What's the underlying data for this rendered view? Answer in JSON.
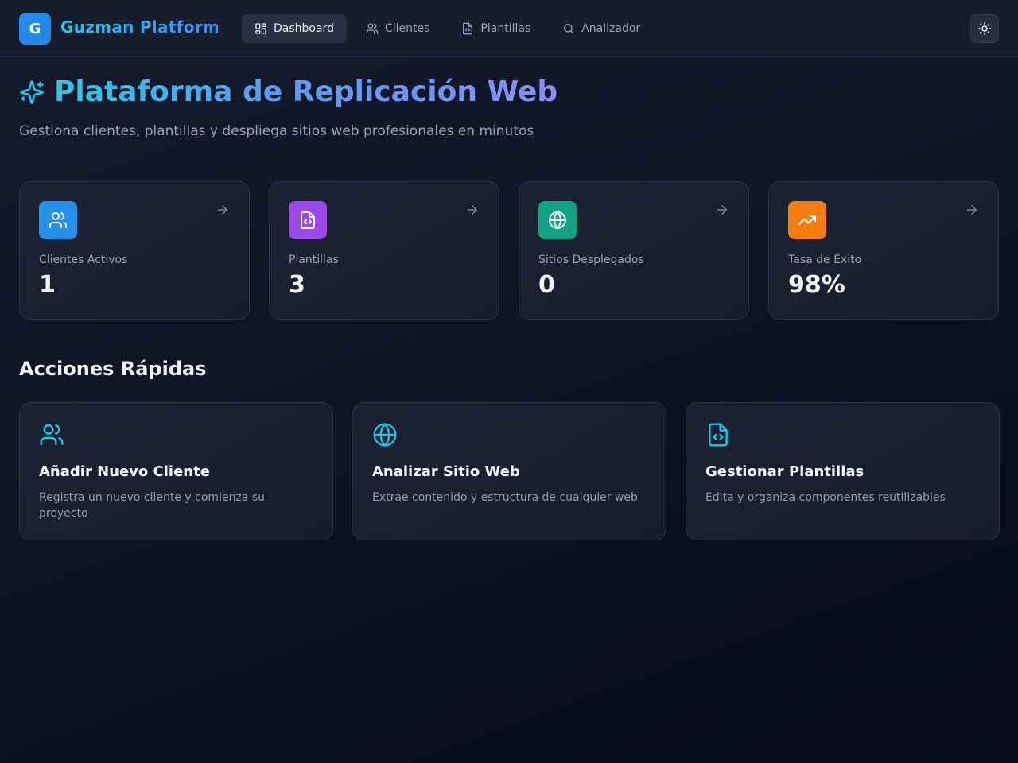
{
  "header": {
    "logo_letter": "G",
    "brand": "Guzman Platform",
    "nav": [
      {
        "label": "Dashboard",
        "icon": "dashboard-icon",
        "active": true
      },
      {
        "label": "Clientes",
        "icon": "users-icon",
        "active": false
      },
      {
        "label": "Plantillas",
        "icon": "file-code-icon",
        "active": false
      },
      {
        "label": "Analizador",
        "icon": "search-icon",
        "active": false
      }
    ],
    "theme_toggle_icon": "sun-icon"
  },
  "hero": {
    "icon": "sparkles-icon",
    "title": "Plataforma de Replicación Web",
    "subtitle": "Gestiona clientes, plantillas y despliega sitios web profesionales en minutos"
  },
  "stats": [
    {
      "label": "Clientes Activos",
      "value": "1",
      "icon": "users-icon",
      "color": "#2590e8"
    },
    {
      "label": "Plantillas",
      "value": "3",
      "icon": "file-code-icon",
      "color": "#9b4ae8"
    },
    {
      "label": "Sitios Desplegados",
      "value": "0",
      "icon": "globe-icon",
      "color": "#11a383"
    },
    {
      "label": "Tasa de Éxito",
      "value": "98%",
      "icon": "trending-up-icon",
      "color": "#f47c12"
    }
  ],
  "quick_actions": {
    "title": "Acciones Rápidas",
    "items": [
      {
        "title": "Añadir Nuevo Cliente",
        "description": "Registra un nuevo cliente y comienza su proyecto",
        "icon": "users-icon"
      },
      {
        "title": "Analizar Sitio Web",
        "description": "Extrae contenido y estructura de cualquier web",
        "icon": "globe-icon"
      },
      {
        "title": "Gestionar Plantillas",
        "description": "Edita y organiza componentes reutilizables",
        "icon": "file-code-icon"
      }
    ]
  },
  "colors": {
    "accent_cyan": "#22c3e6",
    "accent_violet": "#8e8cf2",
    "background": "#0f1525"
  }
}
